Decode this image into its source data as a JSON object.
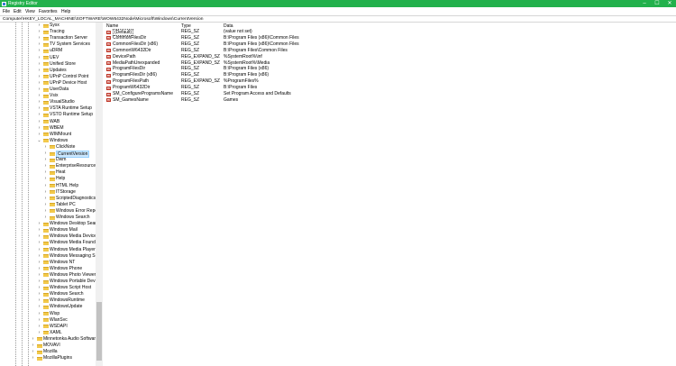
{
  "window": {
    "title": "Registry Editor"
  },
  "menu": {
    "file": "File",
    "edit": "Edit",
    "view": "View",
    "favorites": "Favorites",
    "help": "Help"
  },
  "address": "Computer\\HKEY_LOCAL_MACHINE\\SOFTWARE\\WOW6432Node\\Microsoft\\Windows\\CurrentVersion",
  "tree": {
    "items": [
      {
        "label": "Sysx",
        "level": 1
      },
      {
        "label": "Tracing",
        "level": 1
      },
      {
        "label": "Transaction Server",
        "level": 1
      },
      {
        "label": "TV System Services",
        "level": 1
      },
      {
        "label": "uDRM",
        "level": 1
      },
      {
        "label": "UEV",
        "level": 1
      },
      {
        "label": "Unified Store",
        "level": 1
      },
      {
        "label": "Updates",
        "level": 1
      },
      {
        "label": "UPnP Control Point",
        "level": 1
      },
      {
        "label": "UPnP Device Host",
        "level": 1
      },
      {
        "label": "UserData",
        "level": 1
      },
      {
        "label": "Vsix",
        "level": 1
      },
      {
        "label": "VisualStudio",
        "level": 1
      },
      {
        "label": "VSTA Runtime Setup",
        "level": 1
      },
      {
        "label": "VSTO Runtime Setup",
        "level": 1
      },
      {
        "label": "WAB",
        "level": 1
      },
      {
        "label": "WBEM",
        "level": 1
      },
      {
        "label": "WIMMount",
        "level": 1
      },
      {
        "label": "Windows",
        "level": 1,
        "expanded": true
      },
      {
        "label": "ClickNote",
        "level": 2
      },
      {
        "label": "CurrentVersion",
        "level": 2,
        "selected": true
      },
      {
        "label": "Dwm",
        "level": 2
      },
      {
        "label": "EnterpriseResourceM",
        "level": 2
      },
      {
        "label": "Heat",
        "level": 2
      },
      {
        "label": "Help",
        "level": 2
      },
      {
        "label": "HTML Help",
        "level": 2
      },
      {
        "label": "ITStorage",
        "level": 2
      },
      {
        "label": "ScriptedDiagnosticsPr",
        "level": 2
      },
      {
        "label": "Tablet PC",
        "level": 2
      },
      {
        "label": "Windows Error Report",
        "level": 2
      },
      {
        "label": "Windows Search",
        "level": 2
      },
      {
        "label": "Windows Desktop Search",
        "level": 1
      },
      {
        "label": "Windows Mail",
        "level": 1
      },
      {
        "label": "Windows Media Device M",
        "level": 1
      },
      {
        "label": "Windows Media Foundati",
        "level": 1
      },
      {
        "label": "Windows Media Player N",
        "level": 1
      },
      {
        "label": "Windows Messaging Subs",
        "level": 1
      },
      {
        "label": "Windows NT",
        "level": 1
      },
      {
        "label": "Windows Phone",
        "level": 1
      },
      {
        "label": "Windows Photo Viewer",
        "level": 1
      },
      {
        "label": "Windows Portable Device",
        "level": 1
      },
      {
        "label": "Windows Script Host",
        "level": 1
      },
      {
        "label": "Windows Search",
        "level": 1
      },
      {
        "label": "WindowsRuntime",
        "level": 1
      },
      {
        "label": "WindowsUpdate",
        "level": 1
      },
      {
        "label": "Wisp",
        "level": 1
      },
      {
        "label": "WlanSvc",
        "level": 1
      },
      {
        "label": "WSDAPI",
        "level": 1
      },
      {
        "label": "XAML",
        "level": 1
      },
      {
        "label": "Minnetonka Audio Software",
        "level": 0
      },
      {
        "label": "MOVAVI",
        "level": 0
      },
      {
        "label": "Mozilla",
        "level": 0
      },
      {
        "label": "MozillaPlugins",
        "level": 0
      }
    ]
  },
  "values": {
    "columns": {
      "name": "Name",
      "type": "Type",
      "data": "Data"
    },
    "rows": [
      {
        "name": "(Default)",
        "type": "REG_SZ",
        "data": "(value not set)",
        "default": true
      },
      {
        "name": "CommonFilesDir",
        "type": "REG_SZ",
        "data": "B:\\Program Files (x86)\\Common Files"
      },
      {
        "name": "CommonFilesDir (x86)",
        "type": "REG_SZ",
        "data": "B:\\Program Files (x86)\\Common Files"
      },
      {
        "name": "CommonW6432Dir",
        "type": "REG_SZ",
        "data": "B:\\Program Files\\Common Files"
      },
      {
        "name": "DevicePath",
        "type": "REG_EXPAND_SZ",
        "data": "%SystemRoot%\\inf"
      },
      {
        "name": "MediaPathUnexpanded",
        "type": "REG_EXPAND_SZ",
        "data": "%SystemRoot%\\Media"
      },
      {
        "name": "ProgramFilesDir",
        "type": "REG_SZ",
        "data": "B:\\Program Files (x86)"
      },
      {
        "name": "ProgramFilesDir (x86)",
        "type": "REG_SZ",
        "data": "B:\\Program Files (x86)"
      },
      {
        "name": "ProgramFilesPath",
        "type": "REG_EXPAND_SZ",
        "data": "%ProgramFiles%"
      },
      {
        "name": "ProgramW6432Dir",
        "type": "REG_SZ",
        "data": "B:\\Program Files"
      },
      {
        "name": "SM_ConfigureProgramsName",
        "type": "REG_SZ",
        "data": "Set Program Access and Defaults"
      },
      {
        "name": "SM_GamesName",
        "type": "REG_SZ",
        "data": "Games"
      }
    ]
  }
}
